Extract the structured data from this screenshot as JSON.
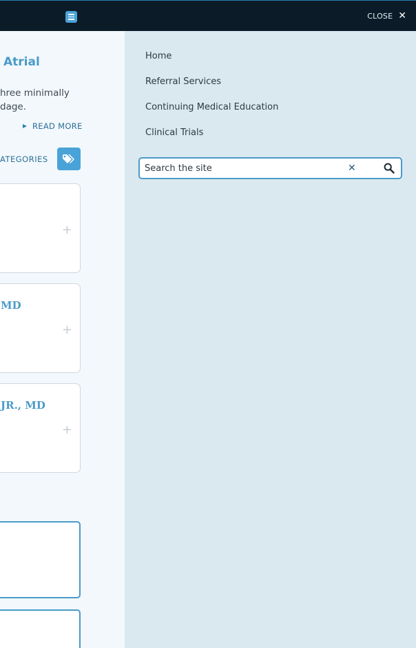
{
  "topbar": {
    "close_label": "CLOSE",
    "close_icon": "close-icon",
    "menu_icon": "hamburger-menu-icon"
  },
  "article": {
    "title_fragment": "Atrial",
    "text_line_1": "hree minimally",
    "text_line_2": "dage.",
    "read_more": "READ MORE",
    "categories_label": "ATEGORIES",
    "tag_icon": "tags-icon"
  },
  "cards": [
    {
      "name": ""
    },
    {
      "name": "MD"
    },
    {
      "name": "JR., MD"
    }
  ],
  "nav": {
    "items": [
      {
        "label": "Home"
      },
      {
        "label": "Referral Services"
      },
      {
        "label": "Continuing Medical Education"
      },
      {
        "label": "Clinical Trials"
      }
    ]
  },
  "search": {
    "placeholder": "Search the site",
    "value": "",
    "clear_icon": "clear-icon",
    "search_icon": "search-icon"
  },
  "colors": {
    "topbar": "#0b1c28",
    "accent": "#4aa3d8",
    "panel": "#dae8f0"
  }
}
